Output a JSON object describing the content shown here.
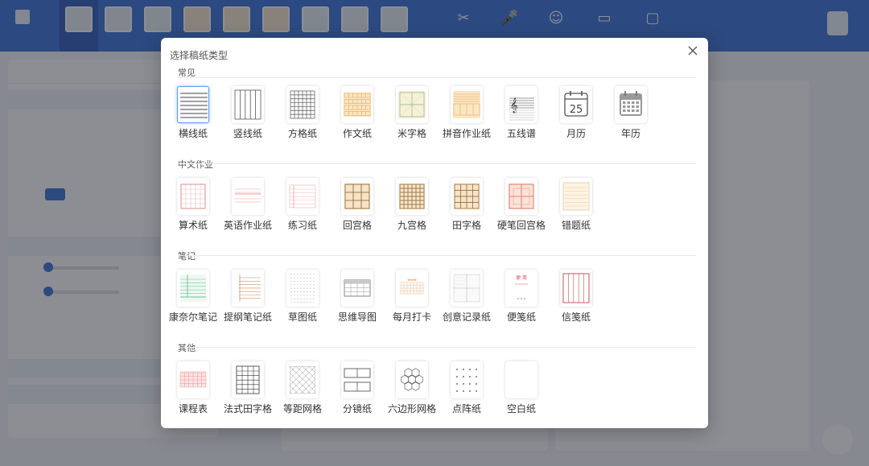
{
  "modal": {
    "title": "选择稿纸类型",
    "sections": [
      {
        "title": "常见",
        "items": [
          {
            "label": "横线纸",
            "icon": "horizontal-lines-icon",
            "selected": true
          },
          {
            "label": "竖线纸",
            "icon": "vertical-lines-icon"
          },
          {
            "label": "方格纸",
            "icon": "square-grid-icon"
          },
          {
            "label": "作文纸",
            "icon": "composition-paper-icon"
          },
          {
            "label": "米字格",
            "icon": "mi-grid-icon"
          },
          {
            "label": "拼音作业纸",
            "icon": "pinyin-paper-icon"
          },
          {
            "label": "五线谱",
            "icon": "music-staff-icon"
          },
          {
            "label": "月历",
            "icon": "monthly-calendar-icon",
            "day": "25"
          },
          {
            "label": "年历",
            "icon": "yearly-calendar-icon"
          }
        ]
      },
      {
        "title": "中文作业",
        "items": [
          {
            "label": "算术纸",
            "icon": "arithmetic-paper-icon"
          },
          {
            "label": "英语作业纸",
            "icon": "english-paper-icon"
          },
          {
            "label": "练习纸",
            "icon": "practice-paper-icon"
          },
          {
            "label": "回宫格",
            "icon": "hui-grid-icon"
          },
          {
            "label": "九宫格",
            "icon": "nine-grid-icon"
          },
          {
            "label": "田字格",
            "icon": "tian-grid-icon"
          },
          {
            "label": "硬笔回宫格",
            "icon": "pen-hui-grid-icon"
          },
          {
            "label": "错题纸",
            "icon": "mistake-paper-icon"
          }
        ]
      },
      {
        "title": "笔记",
        "items": [
          {
            "label": "康奈尔笔记",
            "icon": "cornell-notes-icon"
          },
          {
            "label": "提纲笔记纸",
            "icon": "outline-notes-icon"
          },
          {
            "label": "草图纸",
            "icon": "sketch-paper-icon"
          },
          {
            "label": "思维导图",
            "icon": "mind-map-icon"
          },
          {
            "label": "每月打卡",
            "icon": "monthly-checkin-icon"
          },
          {
            "label": "创意记录纸",
            "icon": "creative-notes-icon"
          },
          {
            "label": "便笺纸",
            "icon": "memo-paper-icon",
            "memo_text": "便 笺"
          },
          {
            "label": "信笺纸",
            "icon": "letter-paper-icon"
          }
        ]
      },
      {
        "title": "其他",
        "items": [
          {
            "label": "课程表",
            "icon": "timetable-icon"
          },
          {
            "label": "法式田字格",
            "icon": "french-grid-icon"
          },
          {
            "label": "等距网格",
            "icon": "isometric-grid-icon"
          },
          {
            "label": "分镜纸",
            "icon": "storyboard-icon"
          },
          {
            "label": "六边形网格",
            "icon": "hexagon-grid-icon"
          },
          {
            "label": "点阵纸",
            "icon": "dot-grid-icon"
          },
          {
            "label": "空白纸",
            "icon": "blank-paper-icon"
          }
        ]
      }
    ]
  },
  "colors": {
    "app_bar": "#2b66d6",
    "selection": "#5b9bf0",
    "overlay": "rgba(45,50,60,0.55)"
  }
}
